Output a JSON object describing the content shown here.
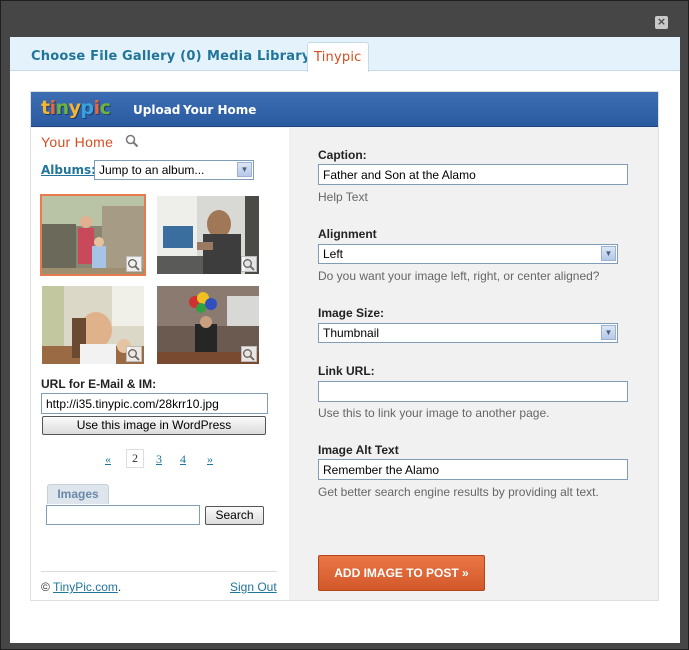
{
  "window": {
    "close_glyph": "×"
  },
  "tabs": [
    {
      "label": "Choose File"
    },
    {
      "label": "Gallery (0)"
    },
    {
      "label": "Media Library"
    },
    {
      "label": "Tinypic",
      "active": true
    }
  ],
  "tinypic": {
    "logo": [
      "t",
      "i",
      "n",
      "y",
      "p",
      "i",
      "c"
    ],
    "logo_colors": [
      "#f2b632",
      "#e8663a",
      "#6cb33e",
      "#f2b632",
      "#3aa3db",
      "#e8663a",
      "#6cb33e"
    ],
    "nav": {
      "upload": "Upload",
      "your_home": "Your Home"
    }
  },
  "left": {
    "heading": "Your Home",
    "albums_label": "Albums:",
    "albums_select": "Jump to an album...",
    "thumbnails": [
      {
        "alt": "outdoor family photo",
        "selected": true
      },
      {
        "alt": "man at desk"
      },
      {
        "alt": "woman in room"
      },
      {
        "alt": "person with balloons"
      }
    ],
    "url_label": "URL for E-Mail & IM:",
    "url_value": "http://i35.tinypic.com/28krr10.jpg",
    "use_button": "Use this image in WordPress",
    "pager": {
      "prev": "«",
      "current": "2",
      "p3": "3",
      "p4": "4",
      "next": "»"
    },
    "images_tab": "Images",
    "search_placeholder": "",
    "search_button": "Search",
    "footer_copy": "©",
    "footer_link": "TinyPic.com",
    "footer_dot": ".",
    "signout": "Sign Out"
  },
  "right": {
    "caption_label": "Caption:",
    "caption_value": "Father and Son at the Alamo",
    "caption_help": "Help Text",
    "alignment_label": "Alignment",
    "alignment_value": "Left",
    "alignment_help": "Do you want your image left, right, or center aligned?",
    "size_label": "Image Size:",
    "size_value": "Thumbnail",
    "link_label": "Link URL:",
    "link_value": "",
    "link_help": "Use this to link your image to another page.",
    "alt_label": "Image Alt Text",
    "alt_value": "Remember the Alamo",
    "alt_help": "Get better search engine results by providing alt text.",
    "add_button": "ADD IMAGE TO POST »"
  }
}
